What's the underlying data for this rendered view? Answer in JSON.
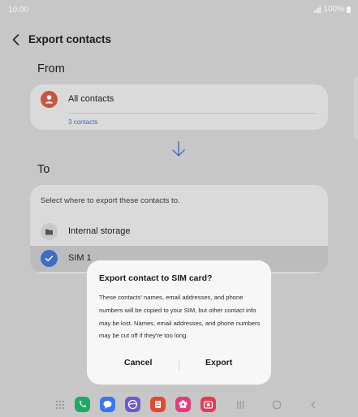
{
  "status_bar": {
    "time": "10:00",
    "battery_text": "100%"
  },
  "header": {
    "title": "Export contacts"
  },
  "from": {
    "label": "From",
    "source_name": "All contacts",
    "count_text": "3 contacts"
  },
  "to": {
    "label": "To",
    "hint": "Select where to export these contacts to.",
    "options": [
      {
        "label": "Internal storage",
        "icon": "folder-icon"
      },
      {
        "label": "SIM 1",
        "icon": "sim-check-icon",
        "selected": true
      }
    ]
  },
  "dialog": {
    "title": "Export contact to SIM card?",
    "body": "These contacts' names, email addresses, and phone numbers will be copied to your SIM, but other contact info may be lost. Names, email addresses, and phone numbers may be cut off if they're too long.",
    "cancel_label": "Cancel",
    "confirm_label": "Export"
  },
  "dock": {
    "apps": [
      {
        "name": "phone",
        "color": "#1faa63"
      },
      {
        "name": "messages",
        "color": "#3a76e8"
      },
      {
        "name": "internet",
        "color": "#6a5ad0"
      },
      {
        "name": "notes",
        "color": "#e04a2f"
      },
      {
        "name": "gallery",
        "color": "#e53b7a"
      },
      {
        "name": "camera",
        "color": "#e23c52"
      }
    ]
  },
  "colors": {
    "accent": "#3f6cc9",
    "dim_background": "#c7c7c7",
    "dialog": "#f7f7f7"
  }
}
